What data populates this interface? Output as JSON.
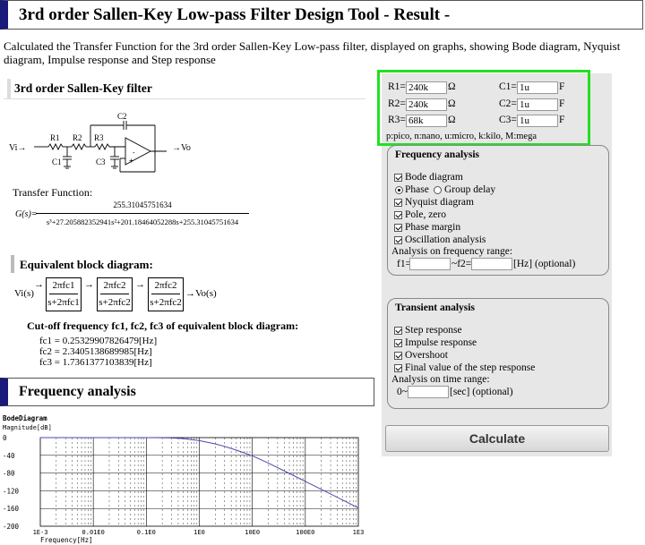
{
  "page": {
    "title": "3rd order Sallen-Key Low-pass Filter Design Tool - Result -",
    "intro": "Calculated the Transfer Function for the 3rd order Sallen-Key Low-pass filter, displayed on graphs, showing Bode diagram, Nyquist diagram, Impulse response and Step response"
  },
  "filter": {
    "heading": "3rd order Sallen-Key filter",
    "labels": {
      "vi": "Vi→",
      "vo": "→Vo",
      "r1": "R1",
      "r2": "R2",
      "r3": "R3",
      "c1": "C1",
      "c2": "C2",
      "c3": "C3"
    }
  },
  "transfer": {
    "label": "Transfer Function:",
    "lhs": "G(s)=",
    "numerator": "255.31045751634",
    "denominator": "s³+27.205882352941s²+201.18464052288s+255.31045751634"
  },
  "block": {
    "heading": "Equivalent block diagram:",
    "input": "Vi(s)",
    "output": "→Vo(s)",
    "boxes": [
      {
        "num": "2πfc1",
        "den": "s+2πfc1"
      },
      {
        "num": "2πfc2",
        "den": "s+2πfc2"
      },
      {
        "num": "2πfc2",
        "den": "s+2πfc2"
      }
    ]
  },
  "cutoff": {
    "heading": "Cut-off frequency fc1, fc2, fc3 of equivalent block diagram:",
    "fc1": "fc1 = 0.25329907826479[Hz]",
    "fc2": "fc2 = 2.3405138689985[Hz]",
    "fc3": "fc3 = 1.7361377103839[Hz]"
  },
  "freq_section": {
    "heading": "Frequency analysis"
  },
  "bode": {
    "title": "BodeDiagram",
    "ylabel": "Magnitude[dB]",
    "xlabel": "Frequency[Hz]",
    "yticks": [
      "0",
      "-40",
      "-80",
      "-120",
      "-160",
      "-200"
    ],
    "xticks": [
      "1E-3",
      "0.01E0",
      "0.1E0",
      "1E0",
      "10E0",
      "100E0",
      "1E3"
    ]
  },
  "chart_data": {
    "type": "line",
    "title": "BodeDiagram",
    "xlabel": "Frequency[Hz]",
    "ylabel": "Magnitude[dB]",
    "xscale": "log",
    "xlim": [
      0.001,
      1000
    ],
    "ylim": [
      -200,
      0
    ],
    "grid": true,
    "x": [
      0.001,
      0.01,
      0.1,
      0.2,
      0.3,
      0.5,
      1,
      2,
      3,
      5,
      10,
      20,
      50,
      100,
      200,
      500,
      1000
    ],
    "series": [
      {
        "values": [
          0,
          0,
          -0.1,
          -0.3,
          -0.8,
          -2.3,
          -6.9,
          -14.2,
          -19.7,
          -28.2,
          -41.1,
          -57.3,
          -80.8,
          -98.7,
          -116.7,
          -140.6,
          -158.7
        ]
      }
    ]
  },
  "params": {
    "r1_label": "R1=",
    "r1": "240k",
    "r1_unit": "Ω",
    "r2_label": "R2=",
    "r2": "240k",
    "r2_unit": "Ω",
    "r3_label": "R3=",
    "r3": "68k",
    "r3_unit": "Ω",
    "c1_label": "C1=",
    "c1": "1u",
    "c1_unit": "F",
    "c2_label": "C2=",
    "c2": "1u",
    "c2_unit": "F",
    "c3_label": "C3=",
    "c3": "1u",
    "c3_unit": "F",
    "prefix_note": "p:pico, n:nano, u:micro, k:kilo, M:mega",
    "highlight_color": "#22e022"
  },
  "freq_panel": {
    "title": "Frequency analysis",
    "bode": "Bode diagram",
    "phase": "Phase",
    "group_delay": "Group delay",
    "nyquist": "Nyquist diagram",
    "pole_zero": "Pole, zero",
    "phase_margin": "Phase margin",
    "oscillation": "Oscillation analysis",
    "range_label": "Analysis on frequency range:",
    "f1_label": "f1=",
    "f2_label": "~f2=",
    "f1_value": "",
    "f2_value": "",
    "unit": "[Hz] (optional)"
  },
  "transient_panel": {
    "title": "Transient analysis",
    "step": "Step response",
    "impulse": "Impulse response",
    "overshoot": "Overshoot",
    "final_value": "Final value of the step response",
    "range_label": "Analysis on time range:",
    "t_label": "0~",
    "t_value": "",
    "unit": "[sec] (optional)"
  },
  "calculate_label": "Calculate"
}
